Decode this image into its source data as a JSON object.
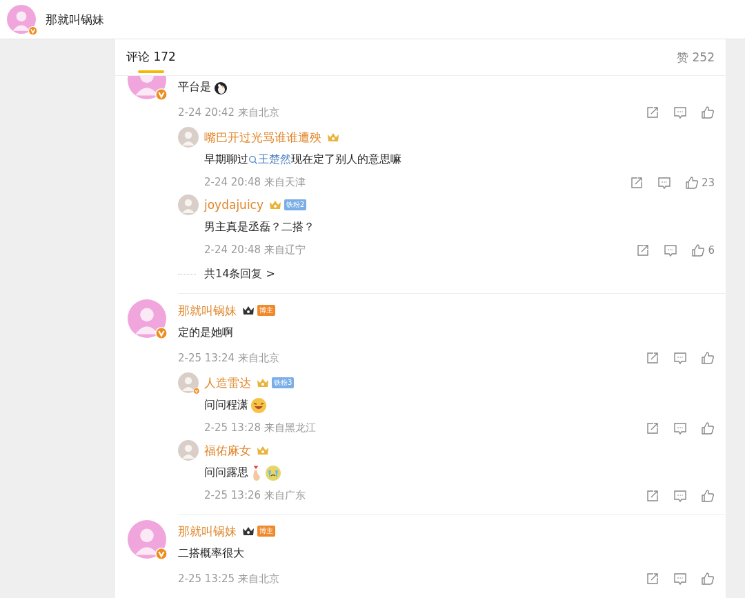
{
  "header": {
    "name": "那就叫锅妹",
    "verified": true
  },
  "tabs": {
    "comments": "评论 172",
    "likes": "赞 252"
  },
  "comments": [
    {
      "author": {
        "verified": true
      },
      "body": [
        {
          "kind": "text",
          "text": "平台是"
        },
        {
          "kind": "penguin"
        }
      ],
      "time": "2-24 20:42 来自北京",
      "replies": [
        {
          "author": {
            "name": "嘴巴开过光骂谁谁遭殃",
            "verified": false,
            "badges": [
              {
                "kind": "crown",
                "color": "#e8b43c"
              }
            ]
          },
          "body": [
            {
              "kind": "text",
              "text": "早期聊过"
            },
            {
              "kind": "mention",
              "text": "王楚然"
            },
            {
              "kind": "text",
              "text": "现在定了别人的意思嘛"
            }
          ],
          "time": "2-24 20:48 来自天津",
          "likes": "23"
        },
        {
          "author": {
            "name": "joydajuicy",
            "verified": false,
            "badges": [
              {
                "kind": "crown",
                "color": "#e8b43c"
              },
              {
                "kind": "tag",
                "text": "铁粉2",
                "color": "#7aaee6"
              }
            ]
          },
          "body": [
            {
              "kind": "text",
              "text": "男主真是丞磊？二搭？"
            }
          ],
          "time": "2-24 20:48 来自辽宁",
          "likes": "6"
        }
      ],
      "more": "共14条回复 >"
    },
    {
      "author": {
        "name": "那就叫锅妹",
        "verified": true,
        "badges": [
          {
            "kind": "crown",
            "color": "#333333"
          },
          {
            "kind": "tag",
            "text": "博主",
            "color": "#f0892c"
          }
        ]
      },
      "body": [
        {
          "kind": "text",
          "text": "定的是她啊"
        }
      ],
      "time": "2-25 13:24 来自北京",
      "replies": [
        {
          "author": {
            "name": "人造雷达",
            "verified": true,
            "badges": [
              {
                "kind": "crown",
                "color": "#e8b43c"
              },
              {
                "kind": "tag",
                "text": "铁粉3",
                "color": "#7aaee6"
              }
            ]
          },
          "body": [
            {
              "kind": "text",
              "text": "问问程潇"
            },
            {
              "kind": "laugh"
            }
          ],
          "time": "2-25 13:28 来自黑龙江"
        },
        {
          "author": {
            "name": "福佑麻女",
            "verified": false,
            "badges": [
              {
                "kind": "crown",
                "color": "#e8b43c"
              }
            ]
          },
          "body": [
            {
              "kind": "text",
              "text": "问问露思"
            },
            {
              "kind": "fingerheart"
            },
            {
              "kind": "cry"
            }
          ],
          "time": "2-25 13:26 来自广东"
        }
      ]
    },
    {
      "author": {
        "name": "那就叫锅妹",
        "verified": true,
        "badges": [
          {
            "kind": "crown",
            "color": "#333333"
          },
          {
            "kind": "tag",
            "text": "博主",
            "color": "#f0892c"
          }
        ]
      },
      "body": [
        {
          "kind": "text",
          "text": "二搭概率很大"
        }
      ],
      "time": "2-25 13:25 来自北京"
    }
  ]
}
